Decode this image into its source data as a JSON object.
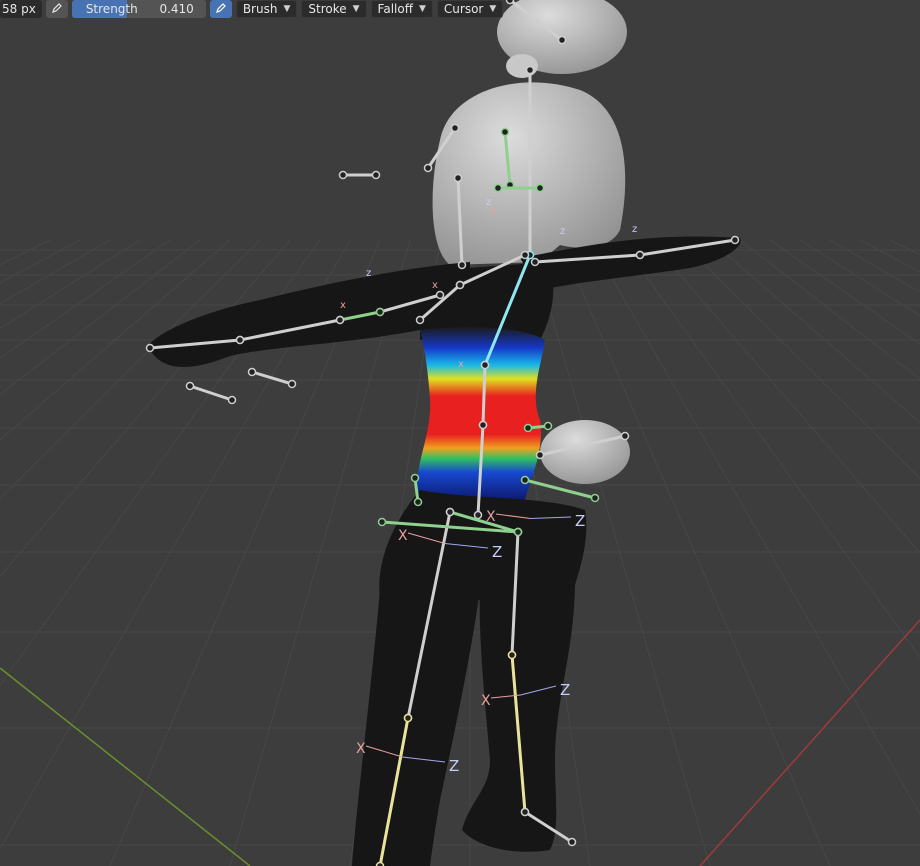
{
  "toolbar": {
    "radius_value": "58 px",
    "strength_label": "Strength",
    "strength_value": "0.410",
    "strength_fraction": 0.41,
    "menus": [
      "Brush",
      "Stroke",
      "Falloff",
      "Cursor"
    ]
  },
  "axis_labels": {
    "x": "X",
    "z": "Z",
    "x_small": "x",
    "z_small": "z"
  },
  "colors": {
    "viewport_bg": "#3d3d3d",
    "grid": "#474747",
    "x_axis": "#a03a3a",
    "y_axis": "#6b8f2e",
    "accent": "#4772b3",
    "bone": "#c9c9c9",
    "bone_selected": "#8fd08f",
    "mesh": "#161616",
    "hair": "#bdbdbd"
  }
}
